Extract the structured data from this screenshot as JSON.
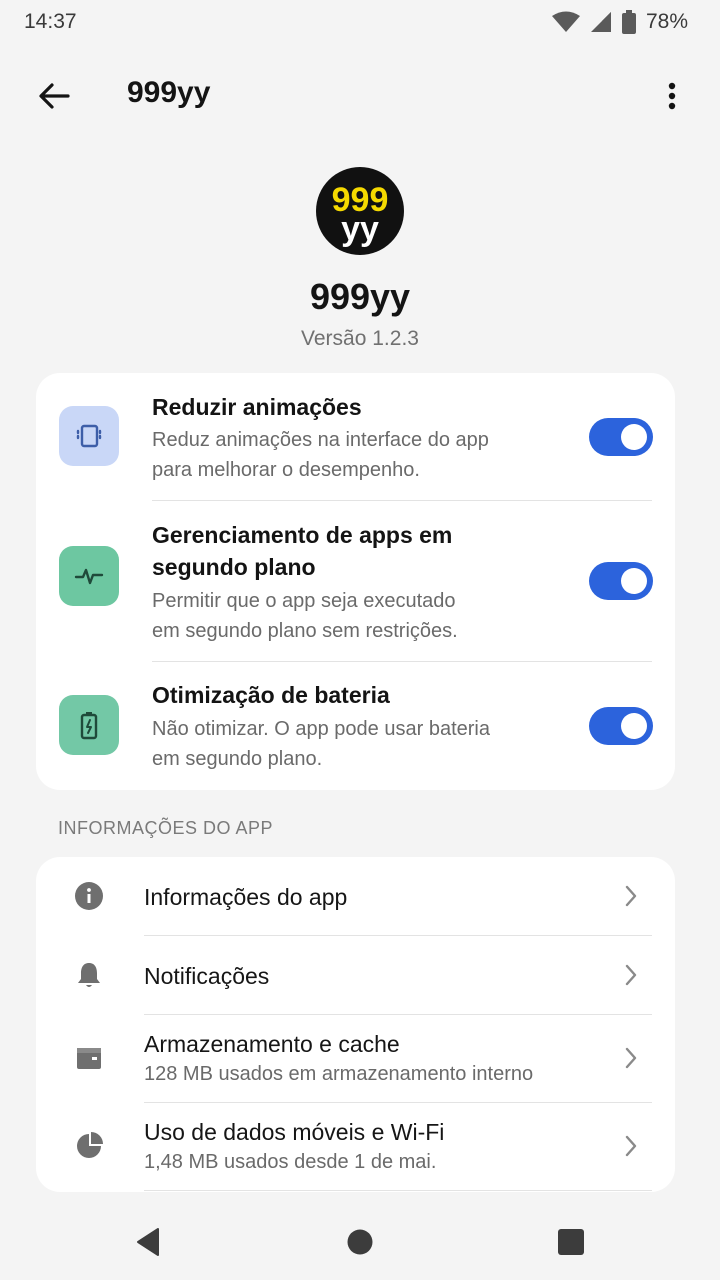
{
  "status_bar": {
    "time": "14:37",
    "battery": "78%",
    "icons": [
      "wifi-icon",
      "cell-signal-icon",
      "battery-icon"
    ]
  },
  "app_bar": {
    "title": "999yy",
    "back_icon": "arrow-back-icon",
    "more_icon": "more-vert-icon"
  },
  "header": {
    "logo_text_top": "999",
    "logo_text_bottom": "yy",
    "app_name": "999yy",
    "version": "Versão 1.2.3"
  },
  "toggles": [
    {
      "title": "Reduzir animações",
      "desc_line1": "Reduz animações na interface do app",
      "desc_line2": "para melhorar o desempenho.",
      "enabled": true,
      "icon": "screen-vibrate-icon"
    },
    {
      "title_line1": "Gerenciamento de apps em",
      "title_line2": "segundo plano",
      "desc_line1": "Permitir que o app seja executado",
      "desc_line2": "em segundo plano sem restrições.",
      "enabled": true,
      "icon": "activity-pulse-icon"
    },
    {
      "title": "Otimização de bateria",
      "desc_line1": "Não otimizar. O app pode usar bateria",
      "desc_line2": "em segundo plano.",
      "enabled": true,
      "icon": "battery-charging-icon"
    }
  ],
  "section": {
    "header": "INFORMAÇÕES DO APP"
  },
  "info_items": [
    {
      "title": "Informações do app",
      "icon": "info-icon"
    },
    {
      "title": "Notificações",
      "icon": "bell-icon"
    },
    {
      "title": "Armazenamento e cache",
      "subtitle": "128 MB usados em armazenamento interno",
      "icon": "storage-icon"
    },
    {
      "title": "Uso de dados móveis e Wi-Fi",
      "subtitle": "1,48 MB usados desde 1 de mai.",
      "icon": "data-usage-pie-icon"
    }
  ],
  "colors": {
    "accent": "#2c63dc",
    "background": "#f4f4f4",
    "card": "#ffffff",
    "logo_yellow": "#f5d900"
  }
}
